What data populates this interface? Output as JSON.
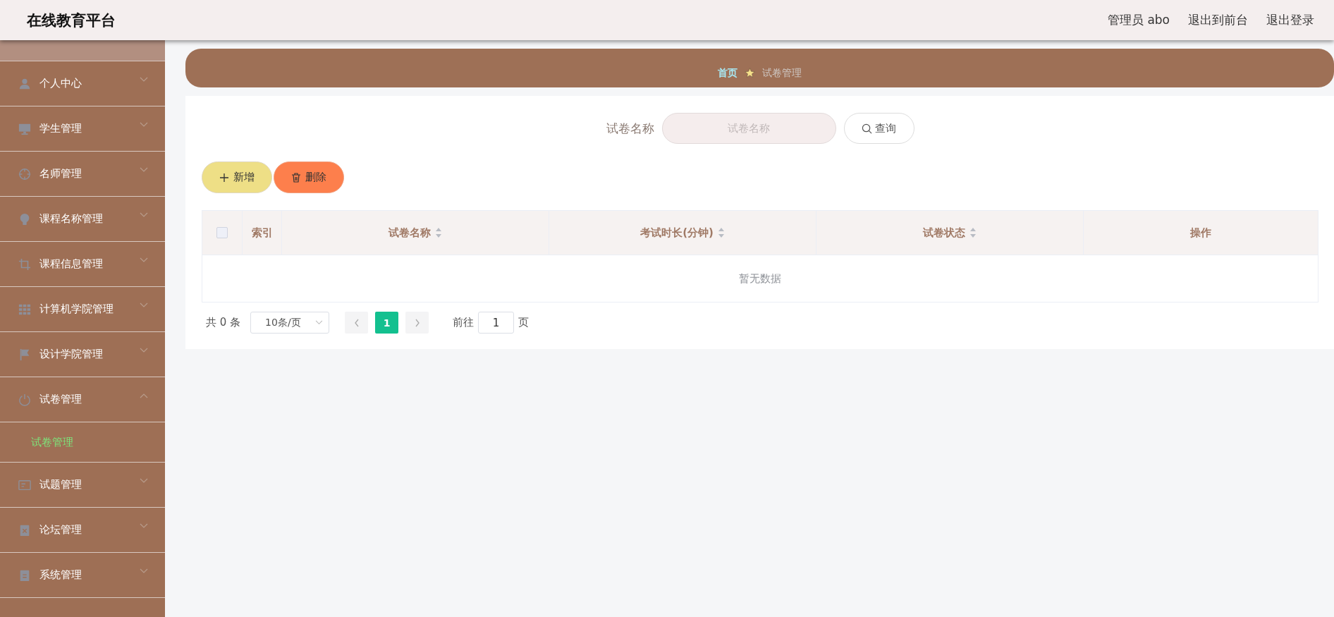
{
  "header": {
    "title": "在线教育平台",
    "links": [
      "管理员 abo",
      "退出到前台",
      "退出登录"
    ]
  },
  "sidebar": {
    "items": [
      {
        "label": "个人中心",
        "expanded": false
      },
      {
        "label": "学生管理",
        "expanded": false
      },
      {
        "label": "名师管理",
        "expanded": false
      },
      {
        "label": "课程名称管理",
        "expanded": false
      },
      {
        "label": "课程信息管理",
        "expanded": false
      },
      {
        "label": "计算机学院管理",
        "expanded": false
      },
      {
        "label": "设计学院管理",
        "expanded": false
      },
      {
        "label": "试卷管理",
        "expanded": true,
        "children": [
          {
            "label": "试卷管理",
            "selected": true
          }
        ]
      },
      {
        "label": "试题管理",
        "expanded": false
      },
      {
        "label": "论坛管理",
        "expanded": false
      },
      {
        "label": "系统管理",
        "expanded": false
      }
    ]
  },
  "breadcrumb": [
    "首页",
    "试卷管理"
  ],
  "search": {
    "label": "试卷名称",
    "placeholder": "试卷名称",
    "button": "查询"
  },
  "actions": [
    {
      "label": "新增",
      "kind": "add"
    },
    {
      "label": "删除",
      "kind": "delete"
    }
  ],
  "table": {
    "select_all": {
      "checked": false
    },
    "columns": [
      {
        "label": "索引",
        "sortable": false
      },
      {
        "label": "试卷名称",
        "sortable": true
      },
      {
        "label": "考试时长(分钟)",
        "sortable": true
      },
      {
        "label": "试卷状态",
        "sortable": true
      },
      {
        "label": "操作",
        "sortable": false
      }
    ],
    "empty_text": "暂无数据"
  },
  "pagination": {
    "total": "共 0 条",
    "page_size": "10条/页",
    "pages": [
      {
        "label": "1",
        "selected": true
      }
    ],
    "goto_label": "前往",
    "goto_value": "1",
    "goto_suffix": "页"
  }
}
